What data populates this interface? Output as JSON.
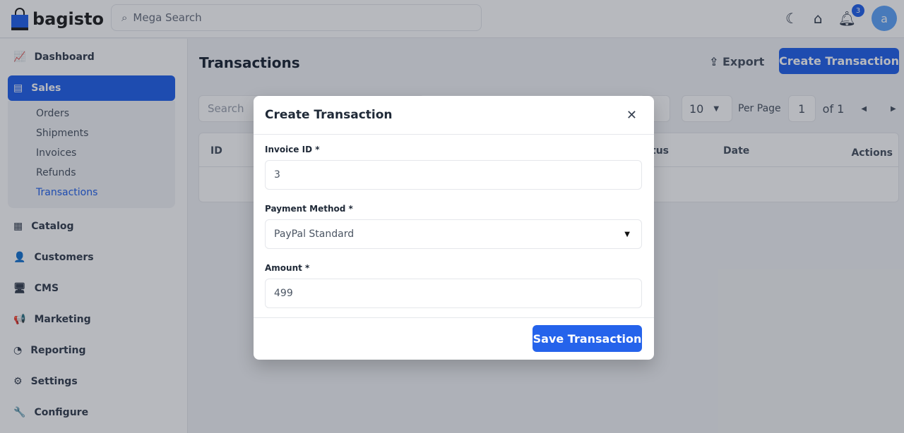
{
  "header": {
    "brand": "bagisto",
    "search_placeholder": "Mega Search",
    "notification_count": "3",
    "avatar_initial": "a"
  },
  "sidebar": {
    "items": [
      {
        "label": "Dashboard",
        "icon": "📈"
      },
      {
        "label": "Sales",
        "icon": "▤"
      },
      {
        "label": "Catalog",
        "icon": "▦"
      },
      {
        "label": "Customers",
        "icon": "👤"
      },
      {
        "label": "CMS",
        "icon": "🖥"
      },
      {
        "label": "Marketing",
        "icon": "📢"
      },
      {
        "label": "Reporting",
        "icon": "◔"
      },
      {
        "label": "Settings",
        "icon": "⚙"
      },
      {
        "label": "Configure",
        "icon": "🔧"
      }
    ],
    "sales_sub": [
      "Orders",
      "Shipments",
      "Invoices",
      "Refunds",
      "Transactions"
    ]
  },
  "main": {
    "title": "Transactions",
    "export_label": "Export",
    "create_label": "Create Transaction",
    "search_placeholder": "Search",
    "per_page": "10",
    "per_page_label": "Per Page",
    "page": "1",
    "page_of": "of 1",
    "columns": [
      "ID",
      "tus",
      "Date",
      "Actions"
    ]
  },
  "modal": {
    "title": "Create Transaction",
    "invoice_label": "Invoice ID *",
    "invoice_value": "3",
    "payment_label": "Payment Method *",
    "payment_value": "PayPal Standard",
    "amount_label": "Amount *",
    "amount_value": "499",
    "save_label": "Save Transaction"
  },
  "colors": {
    "accent": "#2563eb"
  }
}
